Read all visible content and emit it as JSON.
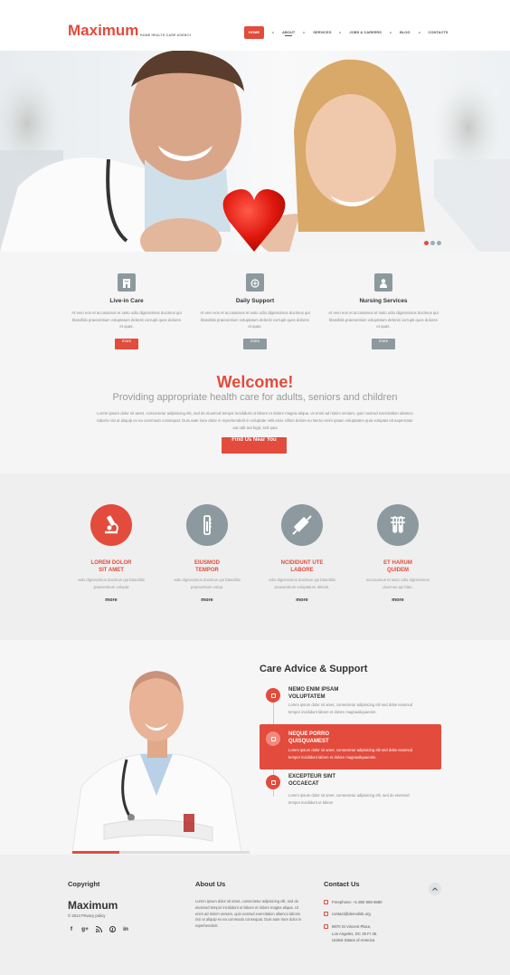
{
  "header": {
    "logo": "Maximum",
    "tagline": "HOME HEALTH CARE AGENCY",
    "nav": [
      {
        "label": "Home"
      },
      {
        "label": "About"
      },
      {
        "label": "Services"
      },
      {
        "label": "Jobs & Careers"
      },
      {
        "label": "Blog"
      },
      {
        "label": "Contacts"
      }
    ]
  },
  "features": [
    {
      "title": "Live-in Care",
      "text": "At vero eos et accusamus et iusto odio dignissimos ducimus qui blanditiis praesentium voluptatum deleniti corrupti quos dolores et quas.",
      "button": "more",
      "icon": "building-icon"
    },
    {
      "title": "Daily Support",
      "text": "At vero eos et accusamus et iusto odio dignissimos ducimus qui blanditiis praesentium voluptatum deleniti corrupti quos dolores et quas.",
      "button": "more",
      "icon": "pill-bottle-icon"
    },
    {
      "title": "Nursing Services",
      "text": "At vero eos et accusamus et iusto odio dignissimos ducimus qui blanditiis praesentium voluptatum deleniti corrupti quos dolores et quas.",
      "button": "more",
      "icon": "nurse-icon"
    }
  ],
  "welcome": {
    "title": "Welcome!",
    "subtitle": "Providing appropriate health care for adults, seniors and children",
    "text": "Lorem ipsum dolor sit amet, consectetur adipisicing elit, sed do eiusmod tempor incididunt ut labore et dolore magna aliqua. Ut enim ad minim veniam, quis nostrud exercitation ullamco laboris nisi ut aliquip ex ea commodo consequat. Duis aute irure dolor in reprehenderit in voluptate velit esse cillum dolore eu Nemo enim ipsam voluptatem quia voluptas sit aspernatur aut odit aut fugit, sed quia",
    "button": "Find Us Near You"
  },
  "services": [
    {
      "title_line1": "LOREM DOLOR",
      "title_line2": "SIT AMET",
      "text_line1": "odio dignissimos ducimus qui blanditiis",
      "text_line2": "praesentium volupta",
      "more": "more",
      "icon": "microscope-icon"
    },
    {
      "title_line1": "EIUSMOD",
      "title_line2": "TEMPOR",
      "text_line1": "odio dignissimos ducimus qui blanditiis",
      "text_line2": "praesentium volup.",
      "more": "more",
      "icon": "thermometer-icon"
    },
    {
      "title_line1": "NCIDIDUNT UTE",
      "title_line2": "LABORE",
      "text_line1": "odio dignissimos ducimus qui blanditiis",
      "text_line2": "praesentium voluptatum delenti.",
      "more": "more",
      "icon": "syringe-icon"
    },
    {
      "title_line1": "ET HARUM",
      "title_line2": "QUIDEM",
      "text_line1": "accusamus et iusto odio dignissimos",
      "text_line2": "ducimus qui blan.",
      "more": "more",
      "icon": "test-tubes-icon"
    }
  ],
  "care": {
    "title": "Care Advice & Support",
    "items": [
      {
        "head_line1": "NEMO ENIM IPSAM",
        "head_line2": "VOLUPTATEM",
        "text_line1": "Lorem ipsum dolor sit amet, consectetur adipisicing elit sed dobe eiusmod",
        "text_line2": "tempor incididunt labore et dolore magnaaliquaenim."
      },
      {
        "head_line1": "NEQUE PORRO",
        "head_line2": "QUISQUAMEST",
        "text_line1": "Lorem ipsum dolor sit amet, consectetur adipisicing elit sed dobe eiusmod",
        "text_line2": "tempor incididunt labore et dolore magnaaliquaenim."
      },
      {
        "head_line1": "EXCEPTEUR SINT",
        "head_line2": "OCCAECAT",
        "text_line1": "Lorem ipsum dolor sit amet, consectetur adipisicing elit, sed do eiusmod",
        "text_line2": "tempor incididunt ut labore"
      }
    ]
  },
  "footer": {
    "copyright_head": "Copyright",
    "brand": "Maximum",
    "copy": "© 2014 Privacy policy",
    "social": [
      "f",
      "g+",
      "rss",
      "p",
      "in"
    ],
    "about_head": "About Us",
    "about_text": "Lorem ipsum dolor sit amet, consectetur adipisicing elit, sed do eiusmod tempor incididunt ut labore et dolore magna aliqua. Ut enim ad minim veniam, quis nostrud exercitation ullamco laboris nisi ut aliquip ex ea commodo consequat. Duis aute irure dolor in reprehenderit.",
    "contact_head": "Contact Us",
    "phone": "Freephone:   +1 800 559 6580",
    "email": "contact@demolink.org",
    "address_line1": "9870 St Vincent Place,",
    "address_line2": "Los Angeles, DC 45 Fr 45.",
    "address_line3": "United States of America"
  },
  "colors": {
    "accent": "#e34b3c",
    "icon_gray": "#8c9a9f"
  }
}
